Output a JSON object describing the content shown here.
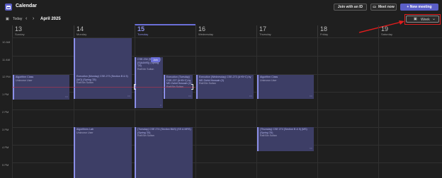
{
  "app": {
    "title": "Calendar"
  },
  "toolbar": {
    "join_with_id": "Join with an ID",
    "meet_now": "Meet now",
    "new_meeting": "+ New meeting"
  },
  "nav": {
    "today": "Today",
    "month": "April 2025",
    "view": "Week"
  },
  "days": [
    {
      "num": "13",
      "name": "Sunday"
    },
    {
      "num": "14",
      "name": "Monday"
    },
    {
      "num": "15",
      "name": "Tuesday"
    },
    {
      "num": "16",
      "name": "Wednesday"
    },
    {
      "num": "17",
      "name": "Thursday"
    },
    {
      "num": "18",
      "name": "Friday"
    },
    {
      "num": "19",
      "name": "Saturday"
    }
  ],
  "times": [
    "10 AM",
    "11 AM",
    "12 PM",
    "1 PM",
    "2 PM",
    "3 PM",
    "4 PM",
    "5 PM"
  ],
  "events": {
    "sun_algo": {
      "title": "Algorithm Class",
      "sub": "Unknown User"
    },
    "mon_exec": {
      "title": "Execution (Monday) CSE-273 (Section B & 5) (MO) (Spring '25)",
      "sub": "Rafi Bin Sultan"
    },
    "tue_cse": {
      "title": "CSE-234 (Section B) (S(A&MS)) (Spring '25)",
      "sub": "Rafi bin Sultan"
    },
    "tue_exec": {
      "title": "Execution (Tuesday) CSE-227 (A+B+C) by MD Zahid Hossain (2)",
      "sub": "Rafi Bin Sultan"
    },
    "wed_exec": {
      "title": "Execution (Wednesday) CSE-273 (A+B+C) by MD Zahid Hossain (3)",
      "sub": "Rafi Bin Sultan"
    },
    "thu_algo": {
      "title": "Algorithm Class",
      "sub": "Unknown User"
    },
    "mon_lab": {
      "title": "Algorithms Lab",
      "sub": "Unknown User"
    },
    "tue_cse2": {
      "title": "(Tuesday) CSE 274 (Section B&S) (SS & MRS) (Spring '25)",
      "sub": "Rafi Bin Sultan"
    },
    "thu_cse": {
      "title": "(Thursday) CSE 274 (Section B & 5) (MS) (Spring '25)",
      "sub": "Rafi Bin Sultan"
    },
    "join_label": "Join"
  }
}
